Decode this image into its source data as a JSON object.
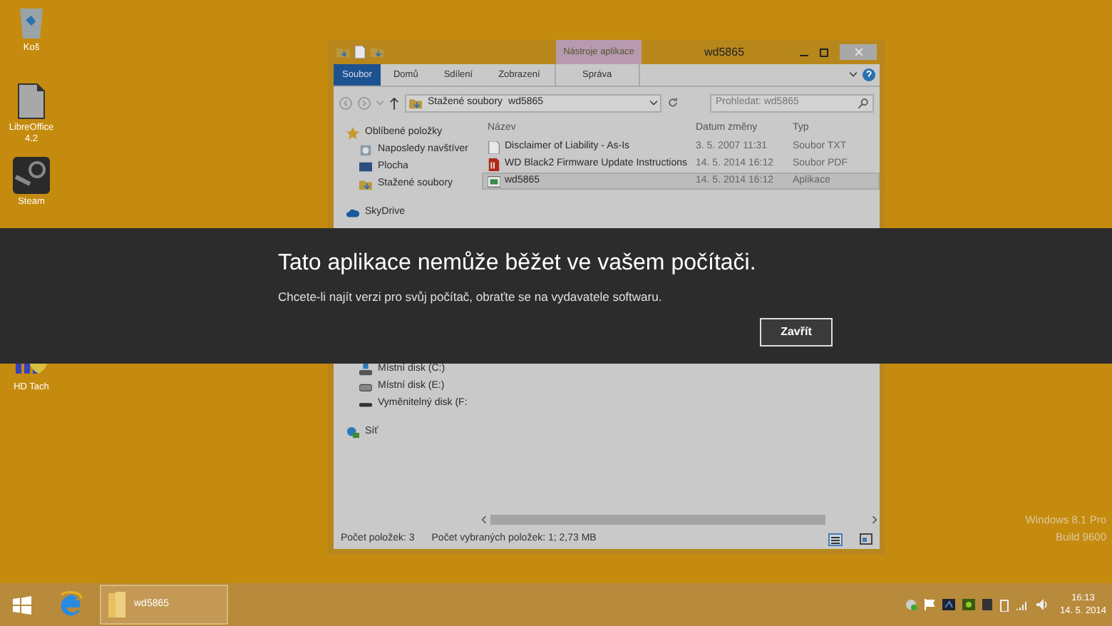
{
  "desktop_icons": [
    {
      "label": "Koš",
      "kind": "bin"
    },
    {
      "label": "LibreOffice 4.2",
      "kind": "doc"
    },
    {
      "label": "Steam",
      "kind": "steam"
    },
    {
      "label": "HD Tach",
      "kind": "chart"
    }
  ],
  "explorer": {
    "title": "wd5865",
    "contextual_tab": "Nástroje aplikace",
    "ribbon_tabs": [
      {
        "label": "Soubor",
        "kind": "file"
      },
      {
        "label": "Domů",
        "kind": "tab"
      },
      {
        "label": "Sdílení",
        "kind": "tab"
      },
      {
        "label": "Zobrazení",
        "kind": "tab"
      },
      {
        "label": "Správa",
        "kind": "context"
      }
    ],
    "address": [
      "Stažené soubory",
      "wd5865"
    ],
    "search": {
      "placeholder": "Prohledat: wd5865"
    },
    "nav": [
      {
        "label": "Oblíbené položky",
        "kind": "favorites",
        "children": [
          {
            "label": "Naposledy navštíver",
            "kind": "recent"
          },
          {
            "label": "Plocha",
            "kind": "desktop"
          },
          {
            "label": "Stažené soubory",
            "kind": "downloads"
          }
        ]
      },
      {
        "label": "SkyDrive",
        "kind": "cloud"
      },
      {
        "children": [
          {
            "label": "Místní disk (C:)",
            "kind": "sysdrive"
          },
          {
            "label": "Místní disk (E:)",
            "kind": "drive"
          },
          {
            "label": "Vyměnitelný disk (F:",
            "kind": "removable"
          }
        ]
      },
      {
        "label": "Síť",
        "kind": "network"
      }
    ],
    "columns": [
      "Název",
      "Datum změny",
      "Typ"
    ],
    "rows": [
      {
        "name": "Disclaimer of Liability - As-Is",
        "date": "3. 5. 2007 11:31",
        "type": "Soubor TXT",
        "kind": "text",
        "selected": false
      },
      {
        "name": "WD Black2 Firmware Update Instructions",
        "date": "14. 5. 2014 16:12",
        "type": "Soubor PDF",
        "kind": "pdf",
        "selected": false
      },
      {
        "name": "wd5865",
        "date": "14. 5. 2014 16:12",
        "type": "Aplikace",
        "kind": "app",
        "selected": true
      }
    ],
    "status": [
      "Počet položek: 3",
      "Počet vybraných položek: 1; 2,73 MB"
    ]
  },
  "dialog": {
    "title": "Tato aplikace nemůže běžet ve vašem počítači.",
    "message": "Chcete-li najít verzi pro svůj počítač, obraťte se na vydavatele softwaru.",
    "button": "Zavřít"
  },
  "watermark": [
    "Windows 8.1 Pro",
    "Build 9600"
  ],
  "taskbar": {
    "apps": [
      {
        "kind": "browser",
        "active": false
      },
      {
        "kind": "folder",
        "label": "wd5865",
        "active": true
      }
    ],
    "time": "16:13",
    "date": "14. 5. 2014"
  }
}
